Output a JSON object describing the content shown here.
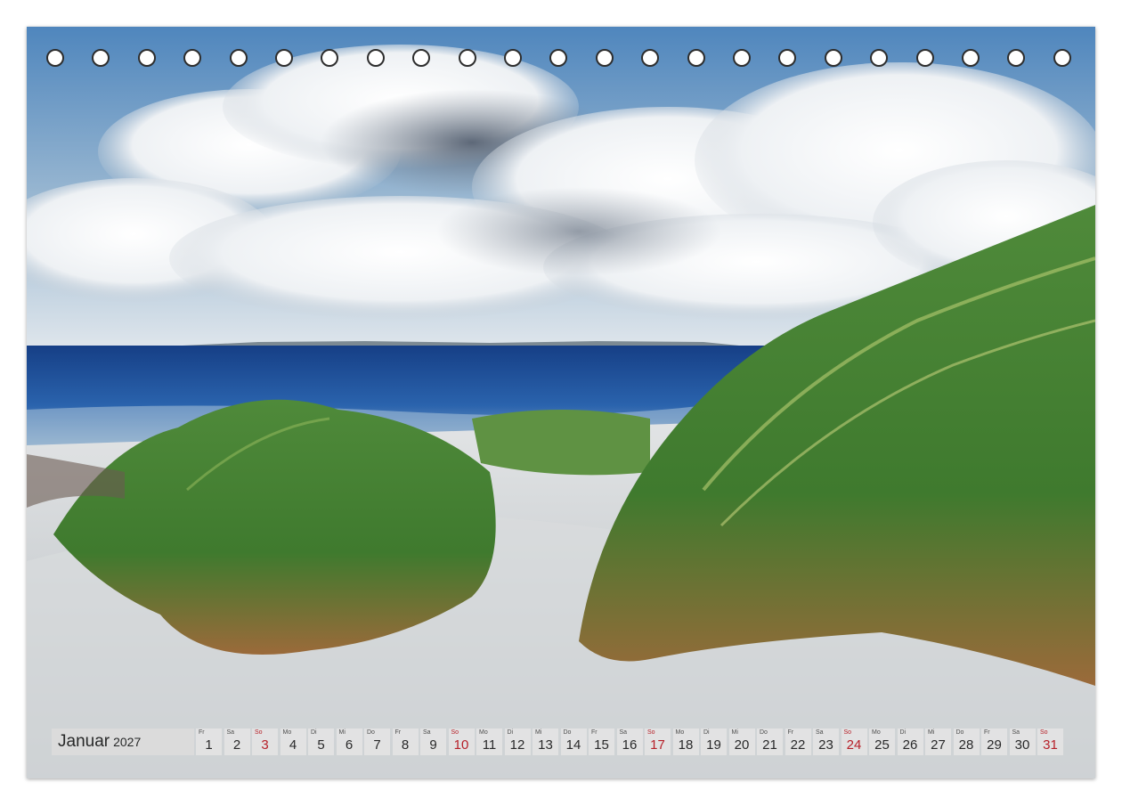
{
  "calendar": {
    "month": "Januar",
    "year": "2027",
    "sunday_color": "#b5121b",
    "days": [
      {
        "wd": "Fr",
        "n": "1"
      },
      {
        "wd": "Sa",
        "n": "2"
      },
      {
        "wd": "So",
        "n": "3",
        "sun": true
      },
      {
        "wd": "Mo",
        "n": "4"
      },
      {
        "wd": "Di",
        "n": "5"
      },
      {
        "wd": "Mi",
        "n": "6"
      },
      {
        "wd": "Do",
        "n": "7"
      },
      {
        "wd": "Fr",
        "n": "8"
      },
      {
        "wd": "Sa",
        "n": "9"
      },
      {
        "wd": "So",
        "n": "10",
        "sun": true
      },
      {
        "wd": "Mo",
        "n": "11"
      },
      {
        "wd": "Di",
        "n": "12"
      },
      {
        "wd": "Mi",
        "n": "13"
      },
      {
        "wd": "Do",
        "n": "14"
      },
      {
        "wd": "Fr",
        "n": "15"
      },
      {
        "wd": "Sa",
        "n": "16"
      },
      {
        "wd": "So",
        "n": "17",
        "sun": true
      },
      {
        "wd": "Mo",
        "n": "18"
      },
      {
        "wd": "Di",
        "n": "19"
      },
      {
        "wd": "Mi",
        "n": "20"
      },
      {
        "wd": "Do",
        "n": "21"
      },
      {
        "wd": "Fr",
        "n": "22"
      },
      {
        "wd": "Sa",
        "n": "23"
      },
      {
        "wd": "So",
        "n": "24",
        "sun": true
      },
      {
        "wd": "Mo",
        "n": "25"
      },
      {
        "wd": "Di",
        "n": "26"
      },
      {
        "wd": "Mi",
        "n": "27"
      },
      {
        "wd": "Do",
        "n": "28"
      },
      {
        "wd": "Fr",
        "n": "29"
      },
      {
        "wd": "Sa",
        "n": "30"
      },
      {
        "wd": "So",
        "n": "31",
        "sun": true
      }
    ]
  },
  "binding": {
    "hole_count": 23
  }
}
